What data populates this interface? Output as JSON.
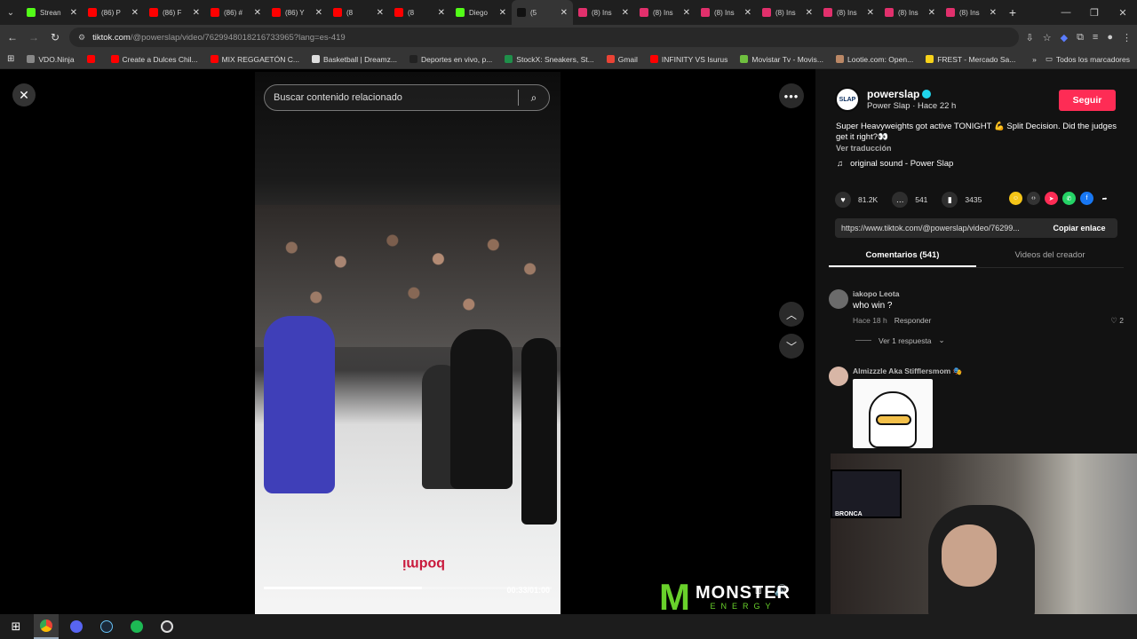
{
  "browser": {
    "tabs": [
      {
        "label": "Strean",
        "favicon": "kick",
        "color": "#53fc18",
        "active": false
      },
      {
        "label": "(86) P",
        "favicon": "youtube",
        "color": "#ff0000",
        "active": false
      },
      {
        "label": "(86) F",
        "favicon": "youtube",
        "color": "#ff0000",
        "active": false
      },
      {
        "label": "(86) #",
        "favicon": "youtube",
        "color": "#ff0000",
        "active": false
      },
      {
        "label": "(86) Y",
        "favicon": "youtube",
        "color": "#ff0000",
        "active": false
      },
      {
        "label": "(8",
        "favicon": "youtube",
        "color": "#ff0000",
        "active": false
      },
      {
        "label": "(8",
        "favicon": "youtube",
        "color": "#ff0000",
        "active": false
      },
      {
        "label": "Diego",
        "favicon": "kick",
        "color": "#53fc18",
        "active": false
      },
      {
        "label": "(5",
        "favicon": "tiktok",
        "color": "#111111",
        "active": true
      },
      {
        "label": "(8) Ins",
        "favicon": "instagram",
        "color": "#e1306c",
        "active": false
      },
      {
        "label": "(8) Ins",
        "favicon": "instagram",
        "color": "#e1306c",
        "active": false
      },
      {
        "label": "(8) Ins",
        "favicon": "instagram",
        "color": "#e1306c",
        "active": false
      },
      {
        "label": "(8) Ins",
        "favicon": "instagram",
        "color": "#e1306c",
        "active": false
      },
      {
        "label": "(8) Ins",
        "favicon": "instagram",
        "color": "#e1306c",
        "active": false
      },
      {
        "label": "(8) Ins",
        "favicon": "instagram",
        "color": "#e1306c",
        "active": false
      },
      {
        "label": "(8) Ins",
        "favicon": "instagram",
        "color": "#e1306c",
        "active": false
      }
    ],
    "address": {
      "host": "tiktok.com",
      "path": "/@powerslap/video/7629948018216733965?lang=es-419"
    },
    "bookmarks": [
      {
        "label": "VDO.Ninja",
        "color": "#888888"
      },
      {
        "label": "",
        "color": "#ff0000"
      },
      {
        "label": "Create a Dulces Chil...",
        "color": "#ff0000"
      },
      {
        "label": "MIX REGGAETÓN C...",
        "color": "#ff0000"
      },
      {
        "label": "Basketball | Dreamz...",
        "color": "#dddddd"
      },
      {
        "label": "Deportes en vivo, p...",
        "color": "#222222"
      },
      {
        "label": "StockX: Sneakers, St...",
        "color": "#1f8f4a"
      },
      {
        "label": "Gmail",
        "color": "#ea4335"
      },
      {
        "label": "INFINITY VS Isurus",
        "color": "#ff0000"
      },
      {
        "label": "Movistar Tv - Movis...",
        "color": "#6fbf3f"
      },
      {
        "label": "Lootie.com: Open...",
        "color": "#bb8866"
      },
      {
        "label": "FREST - Mercado Sa...",
        "color": "#f7d21a"
      }
    ],
    "bookmarks_overflow": "»",
    "all_bookmarks": "Todos los marcadores"
  },
  "player": {
    "search_placeholder": "Buscar contenido relacionado",
    "timecode": "00:33/01:00",
    "progress": 0.55,
    "mat_text": "bodmi"
  },
  "post": {
    "username": "powerslap",
    "subtitle": "Power Slap · Hace 22 h",
    "follow_label": "Seguir",
    "avatar_text": "SLAP",
    "description": "Super Heavyweights got active TONIGHT 💪 Split Decision. Did the judges get it right?👀",
    "see_translation": "Ver traducción",
    "sound": "original sound - Power Slap",
    "likes": "81.2K",
    "comments": "541",
    "saves": "3435",
    "link": "https://www.tiktok.com/@powerslap/video/76299...",
    "copy_link": "Copiar enlace",
    "tab_comments": "Comentarios (541)",
    "tab_creator": "Videos del creador"
  },
  "comments": [
    {
      "user": "iakopo Leota",
      "text": "who win ?",
      "time": "Hace 18 h",
      "reply": "Responder",
      "likes": "2",
      "replies": "Ver 1 respuesta"
    },
    {
      "user": "Almizzzle Aka Stifflersmom 🎭",
      "text": "",
      "time": "",
      "reply": "",
      "likes": "",
      "replies": ""
    }
  ],
  "overlay": {
    "brand": "MONSTER",
    "tagline": "ENERGY",
    "tv_caption": "BRONCA"
  }
}
